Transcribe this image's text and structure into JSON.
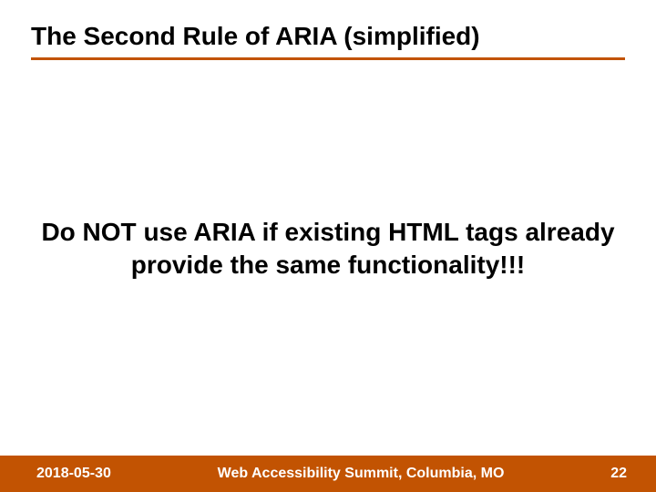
{
  "slide": {
    "title": "The Second Rule of ARIA (simplified)",
    "body": "Do NOT use ARIA if existing HTML tags already provide the same functionality!!!"
  },
  "footer": {
    "date": "2018-05-30",
    "center": "Web Accessibility Summit, Columbia, MO",
    "page": "22"
  },
  "colors": {
    "accent": "#c25302"
  }
}
